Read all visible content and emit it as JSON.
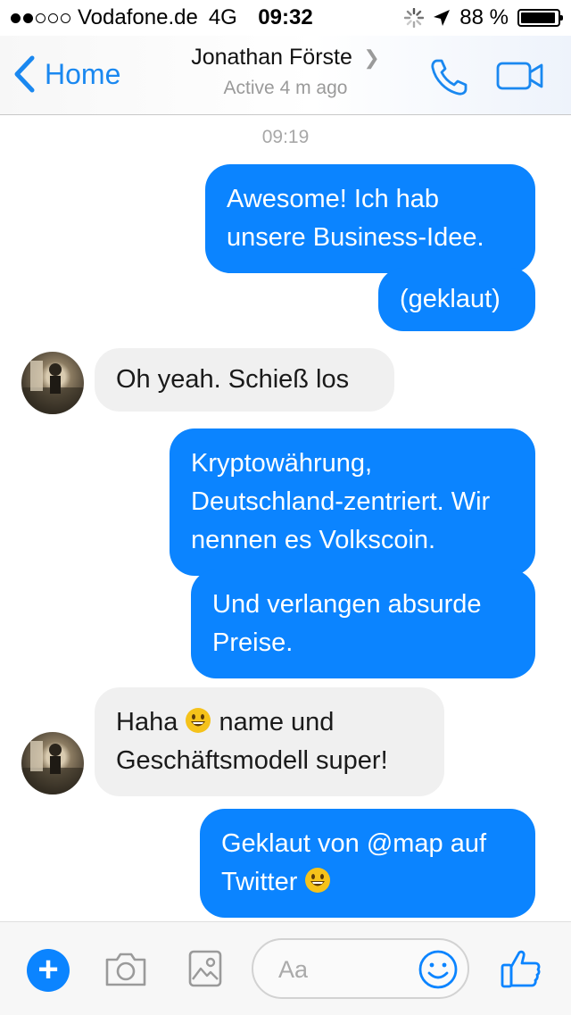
{
  "status_bar": {
    "carrier": "Vodafone.de",
    "network": "4G",
    "time": "09:32",
    "battery": "88 %"
  },
  "nav": {
    "back_label": "Home",
    "contact_name": "Jonathan Förste",
    "contact_status": "Active 4 m ago"
  },
  "chat": {
    "timestamp": "09:19",
    "messages": [
      {
        "from": "me",
        "text": "Awesome! Ich hab unsere Business-Idee."
      },
      {
        "from": "me",
        "text": "(geklaut)"
      },
      {
        "from": "them",
        "text": "Oh yeah. Schieß los"
      },
      {
        "from": "me",
        "text": "Kryptowährung, Deutschland-zentriert. Wir nennen es Volkscoin."
      },
      {
        "from": "me",
        "text": "Und verlangen absurde Preise."
      },
      {
        "from": "them",
        "text_a": "Haha",
        "text_b": "name und Geschäftsmodell super!"
      },
      {
        "from": "me",
        "text": "Geklaut von @map auf Twitter"
      }
    ]
  },
  "composer": {
    "placeholder": "Aa"
  },
  "colors": {
    "accent": "#0b84ff",
    "incoming_bubble": "#f0f0f0"
  },
  "icons": [
    "back-chevron-icon",
    "phone-icon",
    "video-camera-icon",
    "plus-icon",
    "camera-icon",
    "gallery-icon",
    "smiley-icon",
    "thumbs-up-icon",
    "grinning-emoji-icon"
  ]
}
